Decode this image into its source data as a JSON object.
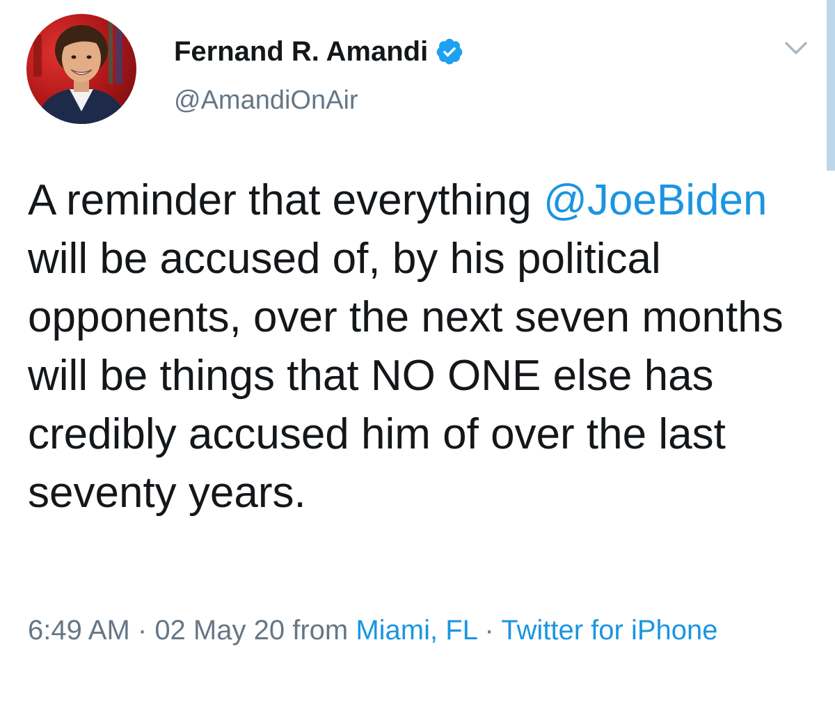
{
  "author": {
    "name": "Fernand R. Amandi",
    "handle": "@AmandiOnAir",
    "verified_icon": "verified-badge-icon",
    "avatar": "profile-photo"
  },
  "menu": {
    "icon": "chevron-down-icon"
  },
  "tweet": {
    "text_before": "A reminder that everything",
    "mention": "@JoeBiden",
    "text_after": "will be accused of, by his political opponents, over the next seven months will be things that NO ONE else has credibly accused him of over the last seventy years."
  },
  "meta": {
    "time": "6:49 AM",
    "separator1": " · ",
    "date": "02 May 20",
    "from_label": " from ",
    "location": "Miami, FL",
    "separator2": " · ",
    "source": "Twitter for iPhone"
  },
  "colors": {
    "link": "#1b95e0",
    "secondary_text": "#657786",
    "primary_text": "#14171a",
    "verified": "#1da1f2",
    "scroll_indicator": "#bcd6ea"
  }
}
